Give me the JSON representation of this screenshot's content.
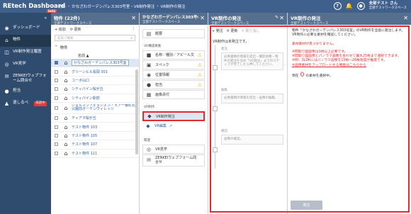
{
  "app": {
    "brand": "REtech Dashboard",
    "beta": "beta"
  },
  "breadcrumb": [
    "物件",
    "かなざわガーデンパレス303号室・VR制作発注",
    "VR制作の発注"
  ],
  "user": {
    "name": "全部テスト さん",
    "org": "全部テストワークスペース",
    "help": "?",
    "bell": "🔔"
  },
  "leftnav": {
    "toggle": "«",
    "items": [
      {
        "label": "ダッシュボード",
        "icon": "dashboard-icon",
        "glyph": "◉"
      },
      {
        "label": "物件",
        "icon": "home-icon",
        "glyph": "⌂"
      },
      {
        "label": "VR制作発注履歴",
        "icon": "history-icon",
        "glyph": "◫"
      },
      {
        "label": "VR見学",
        "icon": "vr-icon",
        "glyph": "◎"
      },
      {
        "label": "ZENKEIウェブフォーム問合せ",
        "icon": "mail-icon",
        "glyph": "✉"
      },
      {
        "label": "担当",
        "icon": "user-icon",
        "glyph": "●"
      },
      {
        "label": "退しるべ",
        "icon": "sign-icon",
        "glyph": "▲"
      }
    ],
    "badge": "未読中"
  },
  "list_panel": {
    "title": "物件 (22件)",
    "subtitle": "全部テストワークスペース",
    "add": "+ 追加",
    "refresh": "⟳ 更新",
    "more": "⋮",
    "search_placeholder": "名前で検索",
    "group": "物件",
    "col_name": "名前 ▲",
    "rows": [
      "かなざわガーデンパレス303号室",
      "グリーンヒル長岡 301",
      "コーポ山口",
      "シティパイン桜が丘",
      "シティパイン駅前",
      "シャルマンアビタシオン・モア一番町北公園前ガーデンヴィレッジ",
      "ティアラ桜が丘",
      "テスト物件 103",
      "テスト物件 105",
      "テスト物件 107",
      "テスト物件 111"
    ]
  },
  "menu_panel": {
    "title": "かなざわガーデンパレス303号室・VR制作発注",
    "subtitle": "全部テストワークスペース",
    "items_top": [
      {
        "label": "概要",
        "glyph": "▤"
      }
    ],
    "section1": "VR構成要素",
    "items1": [
      {
        "label": "名称／種別／アピール文",
        "glyph": "■",
        "warn": true
      },
      {
        "label": "スペック",
        "glyph": "▣",
        "warn": true
      },
      {
        "label": "位置情報",
        "glyph": "◉",
        "warn": true
      },
      {
        "label": "担当",
        "glyph": "●",
        "warn": true
      },
      {
        "label": "画像添付",
        "glyph": "▦",
        "warn": false
      }
    ],
    "section2": "VR制作",
    "order_label": "VR制作発注",
    "edit_label": "VR編集",
    "section3": "関連",
    "items3": [
      {
        "label": "VR見学",
        "glyph": "◎"
      },
      {
        "label": "ZENKEIウェブフォーム問合せ",
        "glyph": "✉"
      }
    ]
  },
  "order_panel": {
    "title": "VR制作の発注",
    "subtitle": "全部テストワークスペース",
    "tools": {
      "order": "+ 発注",
      "refresh": "⟳ 更新",
      "delete": "✕ 取り消し"
    },
    "status": "VR制作は未発注です。",
    "steps": [
      {
        "title": "発注",
        "desc": "必要書類の情報を提出・撮影依頼・物件の発注を含め「VR発注」までのステップが完了したら押してください。"
      },
      {
        "title": "編集",
        "desc": "必要書類の情報を提出・画像の編集。"
      },
      {
        "title": "確認",
        "desc": "画像の確認。"
      }
    ]
  },
  "detail_panel": {
    "line1": "物件「かなざわガーデンパレス303号室」のVR制作を全画に発注します。",
    "line2": "VR制作に必要な素材を確認してください。",
    "notice_title": "素材素材が見つかりません。",
    "notes": [
      "※間取り図画像は1枚以上必要です。",
      "※間取り図画像とパノラマ画像を合わせて最大25枚まで選択できます。",
      "※例：3LDKにはパノラマ画像を15枚〜20枚程度が推奨です。",
      "※画像素材をアップロードする場合はこちらから"
    ],
    "count_prefix": "現在",
    "count": "0",
    "count_suffix": "の素材を選択中。",
    "order_button": "発注"
  },
  "colors": {
    "topbar": "#3f5f8c",
    "nav": "#2f4b6e",
    "highlight": "#e52c2c"
  }
}
